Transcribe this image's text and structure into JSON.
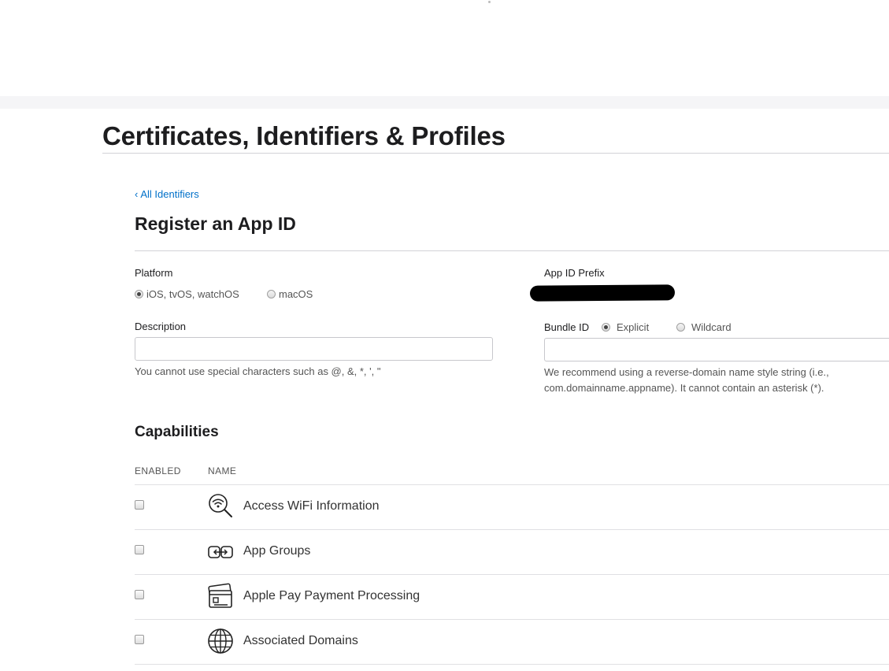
{
  "header": {
    "title": "Certificates, Identifiers & Profiles"
  },
  "nav": {
    "back_chevron": "‹",
    "back_label": "All Identifiers"
  },
  "form": {
    "title": "Register an App ID",
    "platform": {
      "label": "Platform",
      "options": [
        "iOS, tvOS, watchOS",
        "macOS"
      ],
      "selected": "iOS, tvOS, watchOS"
    },
    "app_id_prefix": {
      "label": "App ID Prefix",
      "value_redacted": true
    },
    "description": {
      "label": "Description",
      "value": "",
      "hint": "You cannot use special characters such as @, &, *, ', \""
    },
    "bundle_id": {
      "label": "Bundle ID",
      "options": [
        "Explicit",
        "Wildcard"
      ],
      "selected": "Explicit",
      "value": "",
      "hint_line1": "We recommend using a reverse-domain name style string (i.e.,",
      "hint_line2": "com.domainname.appname). It cannot contain an asterisk (*)."
    }
  },
  "capabilities": {
    "title": "Capabilities",
    "columns": {
      "enabled": "ENABLED",
      "name": "NAME"
    },
    "items": [
      {
        "name": "Access WiFi Information",
        "icon": "wifi-search-icon",
        "enabled": false
      },
      {
        "name": "App Groups",
        "icon": "app-groups-icon",
        "enabled": false
      },
      {
        "name": "Apple Pay Payment Processing",
        "icon": "wallet-card-icon",
        "enabled": false
      },
      {
        "name": "Associated Domains",
        "icon": "globe-icon",
        "enabled": false
      }
    ]
  },
  "colors": {
    "link": "#0070c9",
    "text": "#1d1d1f",
    "muted": "#555555",
    "rule": "#d2d2d7"
  }
}
